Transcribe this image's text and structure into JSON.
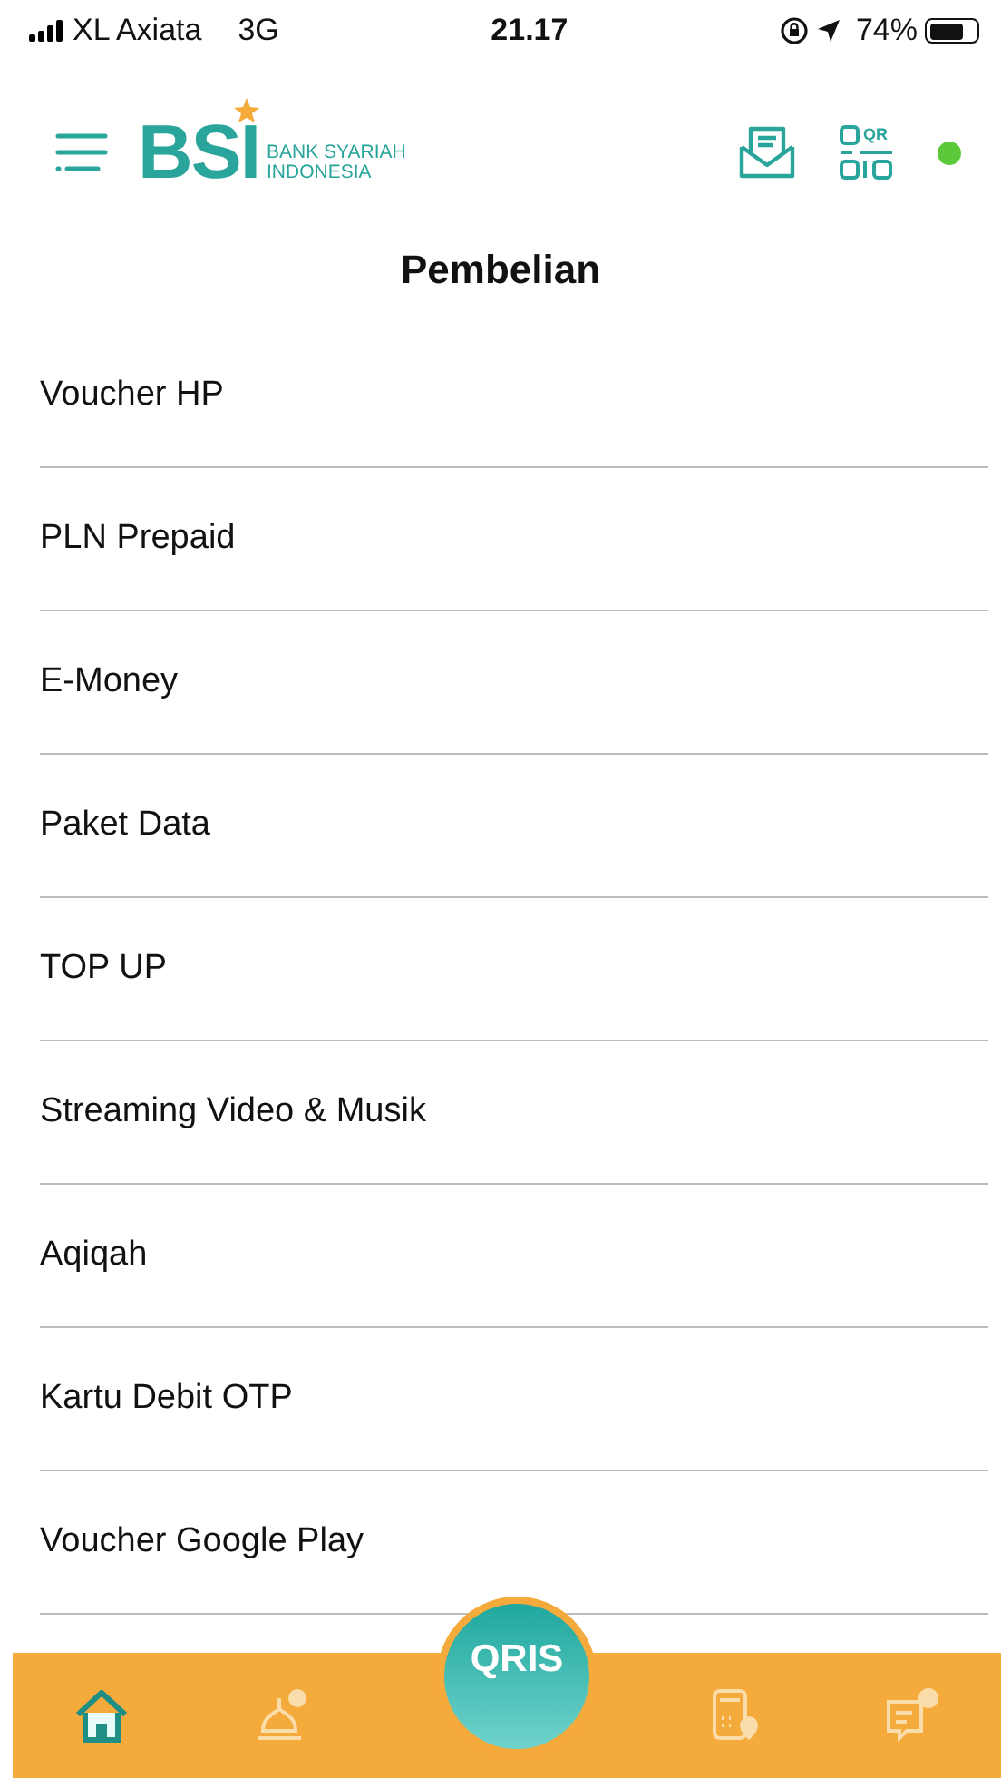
{
  "status_bar": {
    "carrier": "XL Axiata",
    "network": "3G",
    "time": "21.17",
    "battery": {
      "reading": "74%",
      "level": 0.74
    }
  },
  "header": {
    "logo": "BSI",
    "logo_line_1": "BANK SYARIAH",
    "logo_line_2": "INDONESIA",
    "qr_label": "QR",
    "online": true
  },
  "title": "Pembelian",
  "items": [
    {
      "label": "Voucher HP"
    },
    {
      "label": "PLN Prepaid"
    },
    {
      "label": "E-Money"
    },
    {
      "label": "Paket Data"
    },
    {
      "label": "TOP UP"
    },
    {
      "label": "Streaming Video & Musik"
    },
    {
      "label": "Aqiqah"
    },
    {
      "label": "Kartu Debit OTP"
    },
    {
      "label": "Voucher Google Play"
    }
  ],
  "bottom_nav": [
    {
      "kind": "home",
      "selected": true
    },
    {
      "kind": "mosque",
      "selected": false
    },
    {
      "kind": "qris",
      "label": "QRIS",
      "selected": false
    },
    {
      "kind": "atm",
      "selected": false
    },
    {
      "kind": "help",
      "selected": false
    }
  ]
}
